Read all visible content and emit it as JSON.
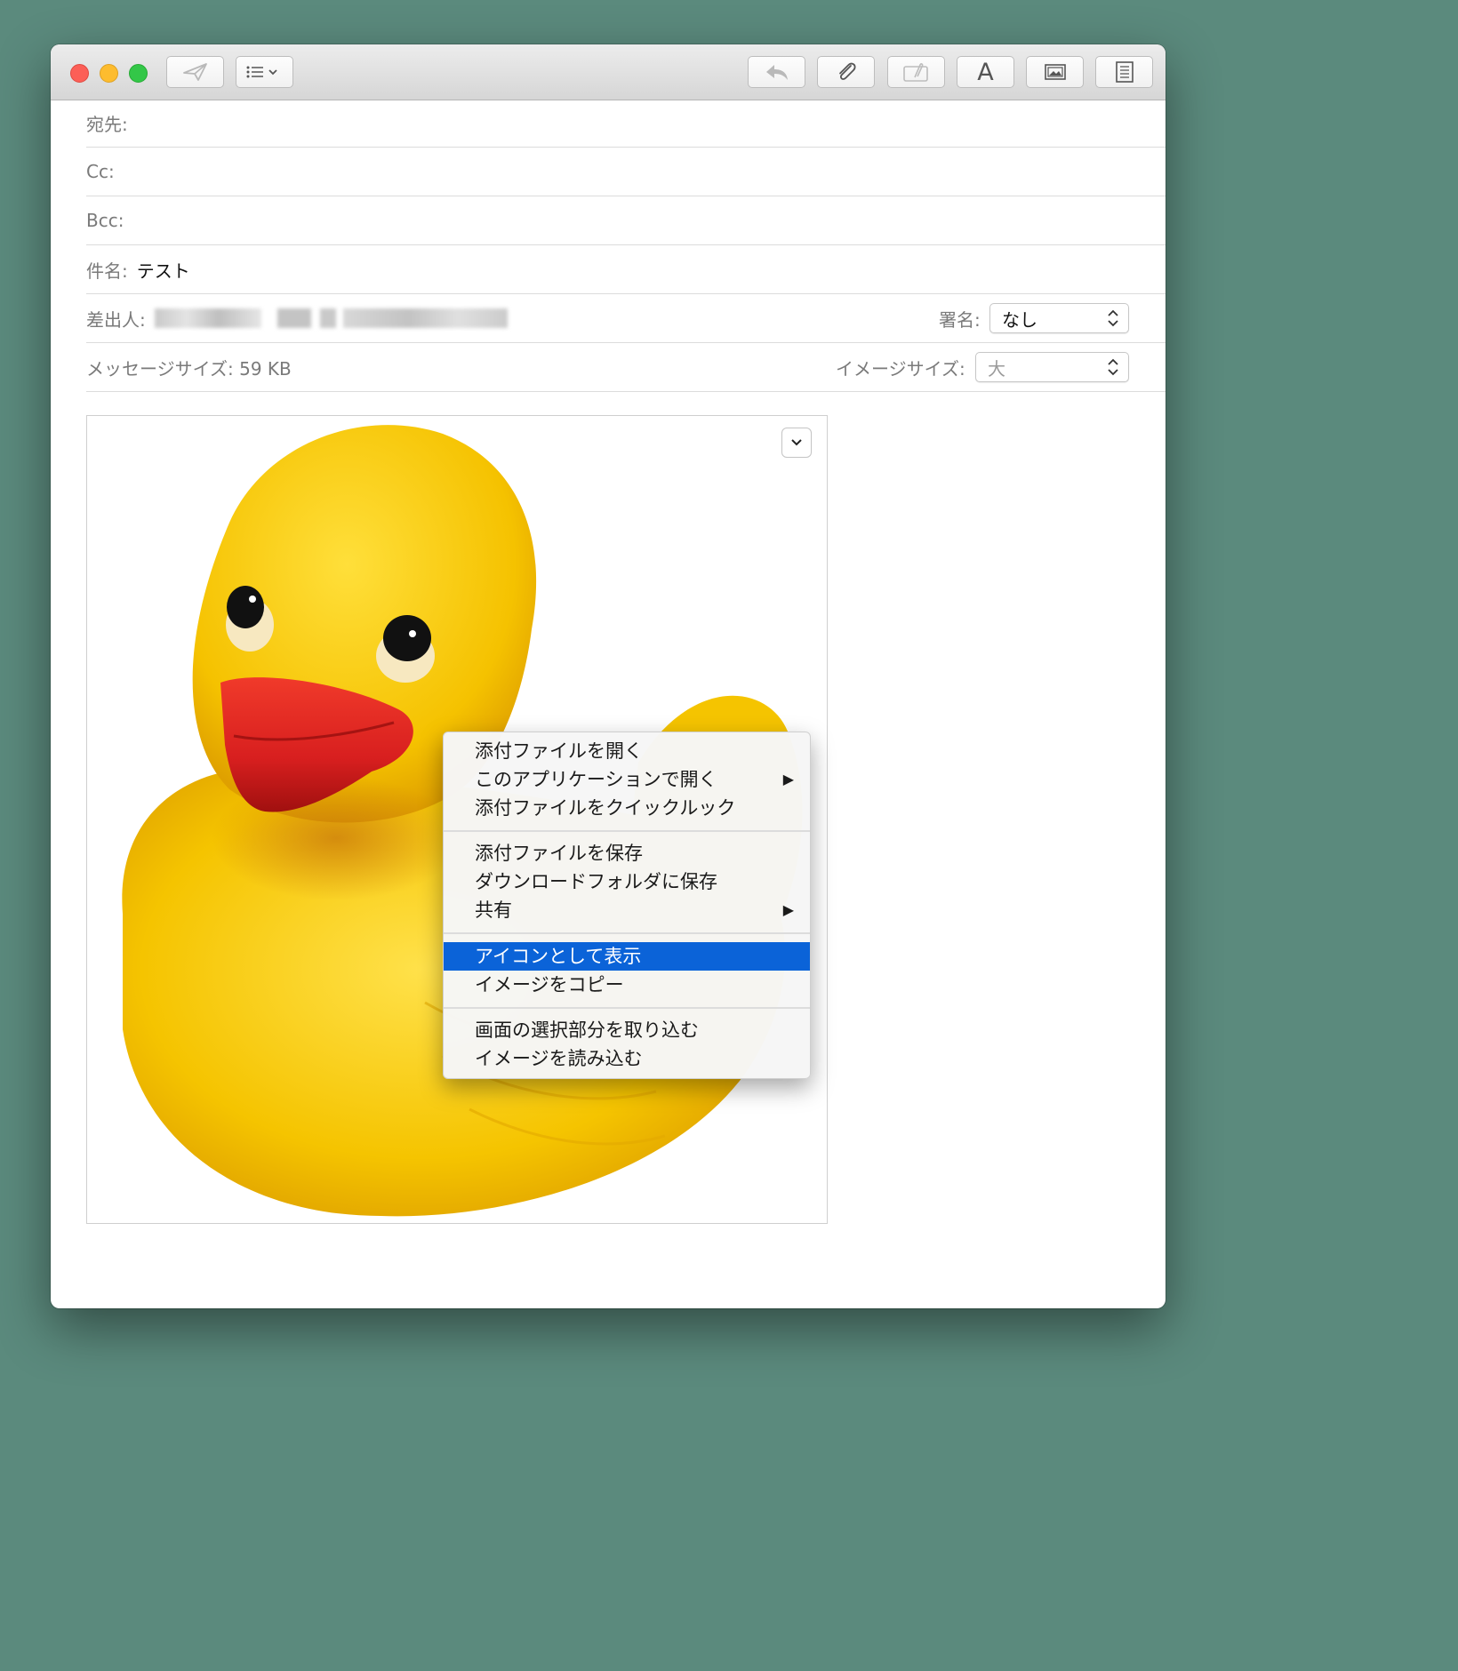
{
  "toolbar": {
    "send_icon": "paper-plane-icon",
    "header_fields_icon": "list-icon",
    "reply_icon": "reply-icon",
    "attach_icon": "paperclip-icon",
    "markup_icon": "markup-icon",
    "format_label": "A",
    "photo_icon": "photo-browser-icon",
    "stationery_icon": "stationery-icon"
  },
  "header": {
    "to_label": "宛先:",
    "cc_label": "Cc:",
    "bcc_label": "Bcc:",
    "subject_label": "件名:",
    "subject_value": "テスト",
    "from_label": "差出人:",
    "signature_label": "署名:",
    "signature_value": "なし",
    "message_size_label": "メッセージサイズ: 59 KB",
    "image_size_label": "イメージサイズ:",
    "image_size_value": "大"
  },
  "colors": {
    "accent": "#0b63d8",
    "duck_body": "#f7c600",
    "duck_beak": "#d81f1f"
  },
  "context_menu": {
    "items": [
      "添付ファイルを開く",
      "このアプリケーションで開く",
      "添付ファイルをクイックルック",
      "添付ファイルを保存",
      "ダウンロードフォルダに保存",
      "共有",
      "アイコンとして表示",
      "イメージをコピー",
      "画面の選択部分を取り込む",
      "イメージを読み込む"
    ],
    "selected": "アイコンとして表示"
  }
}
